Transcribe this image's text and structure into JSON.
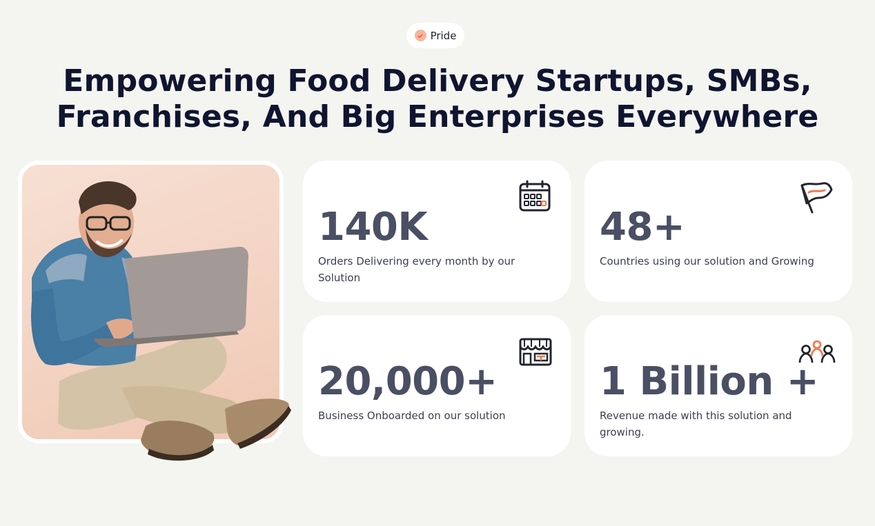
{
  "badge": {
    "label": "Pride",
    "icon": "check-circle-icon"
  },
  "headline": {
    "line1": "Empowering Food Delivery Startups, SMBs,",
    "line2": "Franchises, And Big Enterprises Everywhere"
  },
  "hero_image": {
    "description_icon": "man-with-laptop-photo"
  },
  "stats": [
    {
      "value": "140K",
      "description": "Orders Delivering every month by our Solution",
      "icon": "calendar-icon"
    },
    {
      "value": "48+",
      "description": "Countries using our solution and Growing",
      "icon": "flag-icon"
    },
    {
      "value": "20,000+",
      "description": "Business Onboarded on our solution",
      "icon": "storefront-icon"
    },
    {
      "value": "1 Billion +",
      "description": "Revenue made with this solution and growing.",
      "icon": "users-group-icon"
    }
  ],
  "colors": {
    "background": "#f4f4f0",
    "heading": "#0f1530",
    "stat_value": "#4a4f64",
    "accent": "#f07a50",
    "badge_dot": "#f8b49c",
    "card": "#ffffff"
  }
}
